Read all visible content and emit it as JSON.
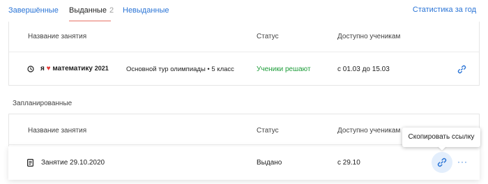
{
  "tabs": {
    "completed": "Завершённые",
    "issued": "Выданные",
    "issued_count": "2",
    "not_issued": "Невыданные"
  },
  "stats_link": "Статистика за год",
  "table_headers": {
    "name": "Название занятия",
    "status": "Статус",
    "available": "Доступно ученикам"
  },
  "issued_rows": [
    {
      "brand_prefix": "я",
      "brand_main": "математику",
      "brand_year": "2021",
      "title": "Основной тур олимпиады • 5 класс",
      "status": "Ученики решают",
      "available": "с 01.03 до 15.03",
      "icon": "clock-icon",
      "action_icon": "link-icon"
    }
  ],
  "planned_label": "Запланированные",
  "planned_rows": [
    {
      "title": "Занятие 29.10.2020",
      "status": "Выдано",
      "available": "с 29.10",
      "icon": "document-icon",
      "action_icon": "link-icon",
      "more_label": "···"
    }
  ],
  "tooltip": "Скопировать ссылку",
  "colors": {
    "link": "#2a74d6",
    "status_green": "#1c9c38",
    "heart": "#e53935",
    "active_tab_underline": "#f2b4ad",
    "link_button_bg": "#e3eefc"
  }
}
